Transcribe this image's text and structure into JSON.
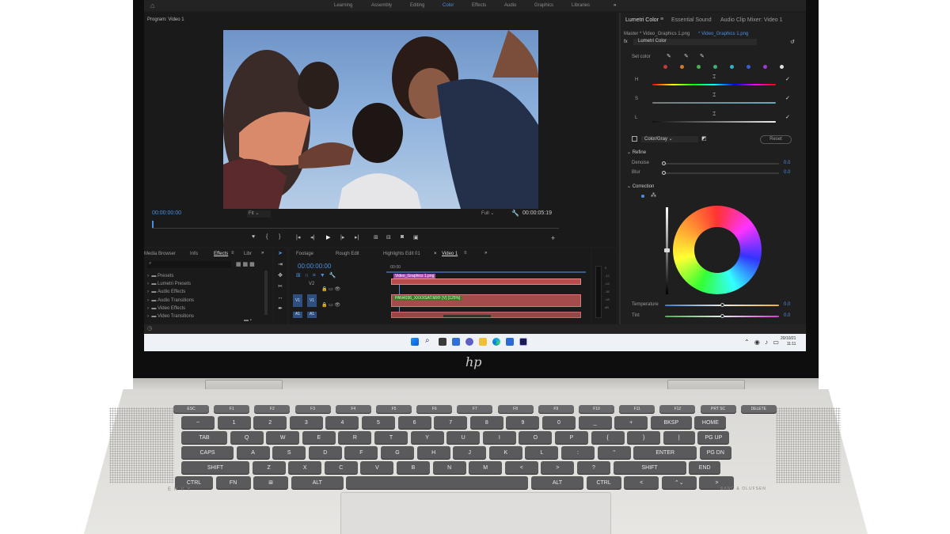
{
  "app": {
    "workspaces": [
      "Learning",
      "Assembly",
      "Editing",
      "Color",
      "Effects",
      "Audio",
      "Graphics",
      "Libraries"
    ],
    "active_workspace": "Color",
    "program_monitor_title": "Program: Video 1",
    "timecode_left": "00:00:00:00",
    "fit_label": "Fit",
    "full_label": "Full",
    "timecode_right": "00:00:05:19"
  },
  "lumetri": {
    "tabs": [
      "Lumetri Color",
      "Essential Sound",
      "Audio Clip Mixer: Video 1"
    ],
    "master_label": "Master * Video_Graphics 1.png",
    "clip_label": "* Video_Graphics 1.png",
    "effect_label": "Lumetri Color",
    "set_color_label": "Set color",
    "hsl_labels": [
      "H",
      "S",
      "L"
    ],
    "color_gray_label": "Color/Gray",
    "reset_label": "Reset",
    "refine_label": "Refine",
    "denoise_label": "Denoise",
    "blur_label": "Blur",
    "denoise_value": "0.0",
    "blur_value": "0.0",
    "correction_label": "Correction",
    "temperature_label": "Temperature",
    "tint_label": "Tint",
    "temperature_value": "0.0",
    "tint_value": "0.0",
    "swatch_colors": [
      "#c23b3b",
      "#d07a2a",
      "#4caf50",
      "#3fae7a",
      "#34b0c8",
      "#3a5fd4",
      "#9a3ad4",
      "#e0e0e0"
    ]
  },
  "effects_panel": {
    "tabs": [
      "Media Browser",
      "Info",
      "Effects",
      "Libr"
    ],
    "active_tab": "Effects",
    "items": [
      "Presets",
      "Lumetri Presets",
      "Audio Effects",
      "Audio Transitions",
      "Video Effects",
      "Video Transitions"
    ]
  },
  "timeline": {
    "tabs": [
      "Footage",
      "Rough Edit",
      "Highlights Edit 01",
      "Video 1"
    ],
    "active_tab": "Video 1",
    "timecode": "00:00:00:00",
    "ruler_start": ":00:00",
    "tracks": [
      "V2",
      "V1",
      "A1"
    ],
    "clip_v2": "Video_Graphics 1.png",
    "clip_v1": "PAN4036_XXXXSAT.MXF [V] [125%]"
  },
  "meter_ticks": [
    "0",
    "-12",
    "-24",
    "-36",
    "-48",
    "dB"
  ],
  "taskbar": {
    "date": "20/10/21",
    "time": "11:11"
  },
  "keyboard": {
    "fn_row": [
      "ESC",
      "F1",
      "F2",
      "F3",
      "F4",
      "F5",
      "F6",
      "F7",
      "F8",
      "F9",
      "F10",
      "F11",
      "F12",
      "PRT SC",
      "DELETE"
    ],
    "row1": [
      "~",
      "1",
      "2",
      "3",
      "4",
      "5",
      "6",
      "7",
      "8",
      "9",
      "0",
      "_",
      "+",
      "BKSP",
      "HOME"
    ],
    "row2": [
      "TAB",
      "Q",
      "W",
      "E",
      "R",
      "T",
      "Y",
      "U",
      "I",
      "O",
      "P",
      "{",
      "}",
      "|",
      "PG UP"
    ],
    "row3": [
      "CAPS",
      "A",
      "S",
      "D",
      "F",
      "G",
      "H",
      "J",
      "K",
      "L",
      ":",
      "\"",
      "ENTER",
      "PG DN"
    ],
    "row4": [
      "SHIFT",
      "Z",
      "X",
      "C",
      "V",
      "B",
      "N",
      "M",
      "<",
      ">",
      "?",
      "SHIFT",
      "END"
    ],
    "row5": [
      "CTRL",
      "FN",
      "⊞",
      "ALT",
      "",
      "ALT",
      "CTRL",
      "<",
      "⌃⌄",
      ">"
    ],
    "left_brand": "ENVY",
    "right_brand": "BANG & OLUFSEN"
  }
}
